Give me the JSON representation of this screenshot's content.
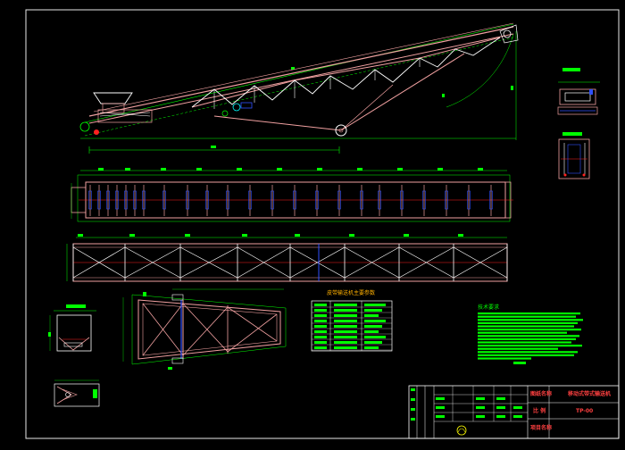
{
  "colors": {
    "background": "#000000",
    "frame": "#e8e8e8",
    "structure": "#f0a0a0",
    "member": "#ffffff",
    "dimension": "#00ff00",
    "accent_blue": "#3050ff",
    "accent_cyan": "#00ffff",
    "accent_red": "#ff2020",
    "title_text": "#ff4040"
  },
  "title_block": {
    "drawing_name_label": "图纸名称",
    "drawing_name": "移动式带式输送机",
    "scale_label": "比 例",
    "drawing_no": "TP-00",
    "project_label": "项目名称"
  },
  "spec_table": {
    "title": "皮带输送机主要参数"
  },
  "notes": {
    "heading": "技术要求"
  }
}
